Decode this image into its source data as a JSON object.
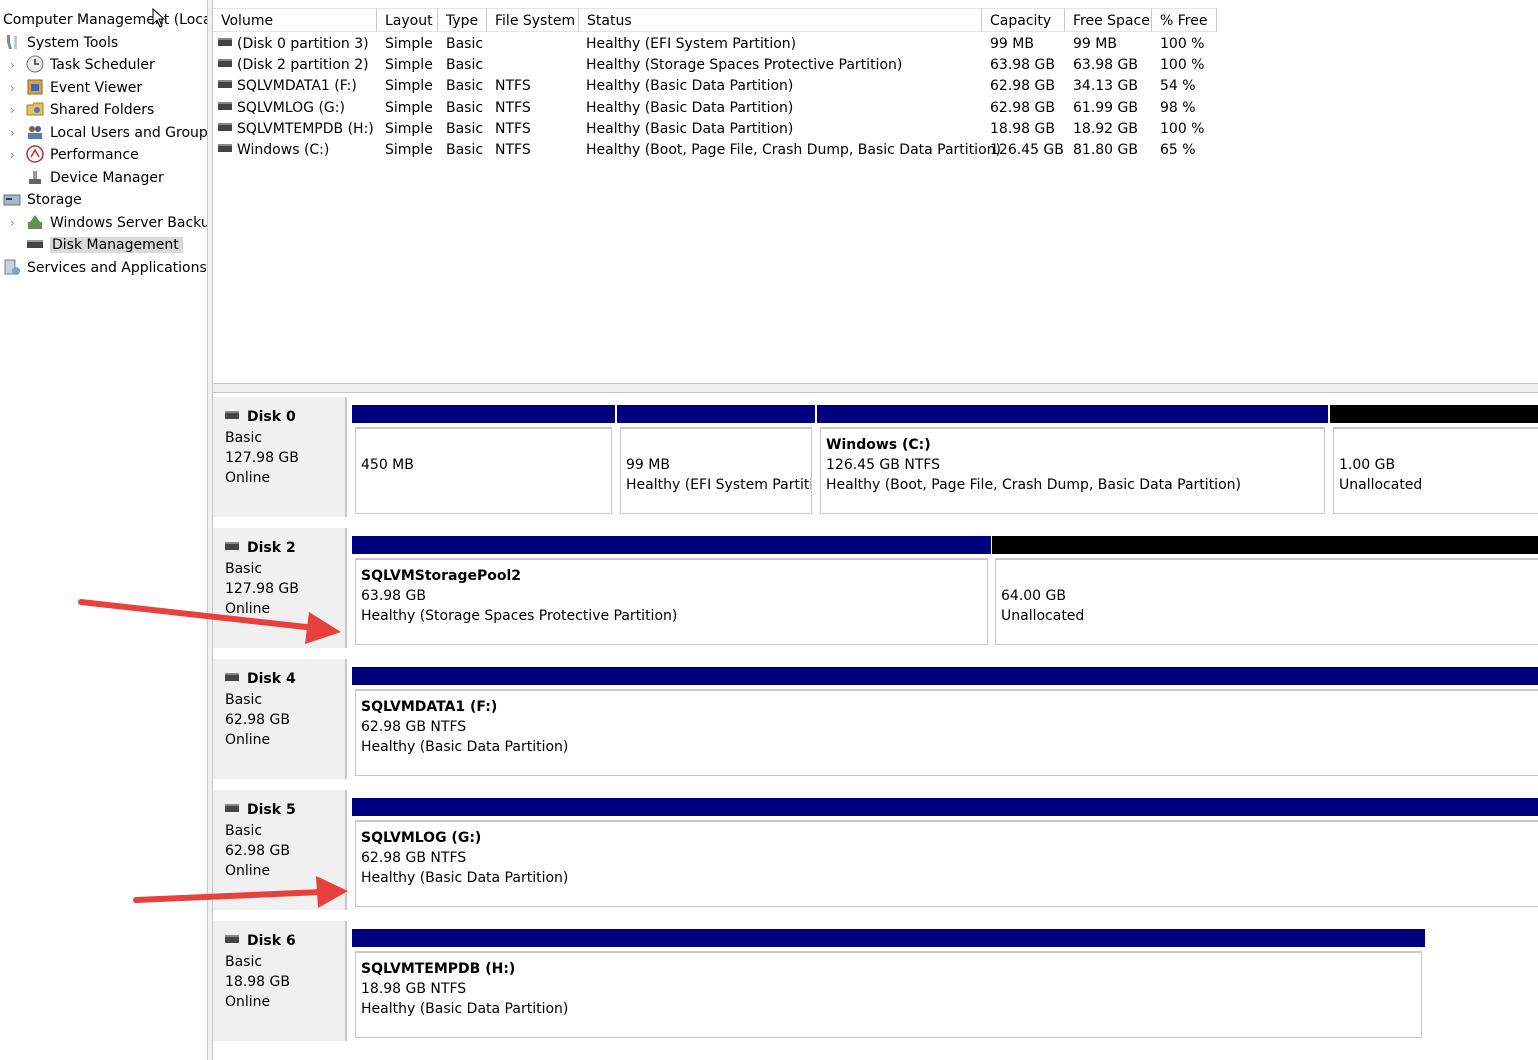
{
  "tree": {
    "root": "Computer Management (Local)",
    "items": [
      {
        "label": "System Tools",
        "icon": "tools-icon",
        "level": 0
      },
      {
        "label": "Task Scheduler",
        "icon": "clock-icon",
        "level": 1
      },
      {
        "label": "Event Viewer",
        "icon": "event-viewer-icon",
        "level": 1
      },
      {
        "label": "Shared Folders",
        "icon": "shared-folder-icon",
        "level": 1
      },
      {
        "label": "Local Users and Groups",
        "icon": "users-icon",
        "level": 1
      },
      {
        "label": "Performance",
        "icon": "performance-icon",
        "level": 1
      },
      {
        "label": "Device Manager",
        "icon": "device-manager-icon",
        "level": 1
      },
      {
        "label": "Storage",
        "icon": "storage-icon",
        "level": 0
      },
      {
        "label": "Windows Server Backup",
        "icon": "backup-icon",
        "level": 1
      },
      {
        "label": "Disk Management",
        "icon": "disk-management-icon",
        "level": 1,
        "selected": true
      },
      {
        "label": "Services and Applications",
        "icon": "services-icon",
        "level": 0
      }
    ]
  },
  "volumes": {
    "columns": [
      "Volume",
      "Layout",
      "Type",
      "File System",
      "Status",
      "Capacity",
      "Free Space",
      "% Free"
    ],
    "rows": [
      [
        "(Disk 0 partition 3)",
        "Simple",
        "Basic",
        "",
        "Healthy (EFI System Partition)",
        "99 MB",
        "99 MB",
        "100 %"
      ],
      [
        "(Disk 2 partition 2)",
        "Simple",
        "Basic",
        "",
        "Healthy (Storage Spaces Protective Partition)",
        "63.98 GB",
        "63.98 GB",
        "100 %"
      ],
      [
        "SQLVMDATA1 (F:)",
        "Simple",
        "Basic",
        "NTFS",
        "Healthy (Basic Data Partition)",
        "62.98 GB",
        "34.13 GB",
        "54 %"
      ],
      [
        "SQLVMLOG (G:)",
        "Simple",
        "Basic",
        "NTFS",
        "Healthy (Basic Data Partition)",
        "62.98 GB",
        "61.99 GB",
        "98 %"
      ],
      [
        "SQLVMTEMPDB (H:)",
        "Simple",
        "Basic",
        "NTFS",
        "Healthy (Basic Data Partition)",
        "18.98 GB",
        "18.92 GB",
        "100 %"
      ],
      [
        "Windows (C:)",
        "Simple",
        "Basic",
        "NTFS",
        "Healthy (Boot, Page File, Crash Dump, Basic Data Partition)",
        "126.45 GB",
        "81.80 GB",
        "65 %"
      ]
    ]
  },
  "disks": [
    {
      "name": "Disk 0",
      "type": "Basic",
      "size": "127.98 GB",
      "status": "Online",
      "partitions": [
        {
          "title": "",
          "line1": "450 MB",
          "line2": "",
          "kind": "primary"
        },
        {
          "title": "",
          "line1": "99 MB",
          "line2": "Healthy (EFI System Partitic",
          "kind": "primary"
        },
        {
          "title": "Windows  (C:)",
          "line1": "126.45 GB NTFS",
          "line2": "Healthy (Boot, Page File, Crash Dump, Basic Data Partition)",
          "kind": "primary"
        },
        {
          "title": "",
          "line1": "1.00 GB",
          "line2": "Unallocated",
          "kind": "unallocated"
        }
      ]
    },
    {
      "name": "Disk 2",
      "type": "Basic",
      "size": "127.98 GB",
      "status": "Online",
      "partitions": [
        {
          "title": "SQLVMStoragePool2",
          "line1": "63.98 GB",
          "line2": "Healthy (Storage Spaces Protective Partition)",
          "kind": "primary"
        },
        {
          "title": "",
          "line1": "64.00 GB",
          "line2": "Unallocated",
          "kind": "unallocated"
        }
      ]
    },
    {
      "name": "Disk 4",
      "type": "Basic",
      "size": "62.98 GB",
      "status": "Online",
      "partitions": [
        {
          "title": "SQLVMDATA1  (F:)",
          "line1": "62.98 GB NTFS",
          "line2": "Healthy (Basic Data Partition)",
          "kind": "primary"
        }
      ]
    },
    {
      "name": "Disk 5",
      "type": "Basic",
      "size": "62.98 GB",
      "status": "Online",
      "partitions": [
        {
          "title": "SQLVMLOG  (G:)",
          "line1": "62.98 GB NTFS",
          "line2": "Healthy (Basic Data Partition)",
          "kind": "primary"
        }
      ]
    },
    {
      "name": "Disk 6",
      "type": "Basic",
      "size": "18.98 GB",
      "status": "Online",
      "partitions": [
        {
          "title": "SQLVMTEMPDB  (H:)",
          "line1": "18.98 GB NTFS",
          "line2": "Healthy (Basic Data Partition)",
          "kind": "primary"
        }
      ]
    }
  ],
  "colors": {
    "primary_partition": "#00007f",
    "unallocated": "#000000",
    "annotation_arrow": "#e8403c",
    "selection": "#d9d9d9"
  }
}
